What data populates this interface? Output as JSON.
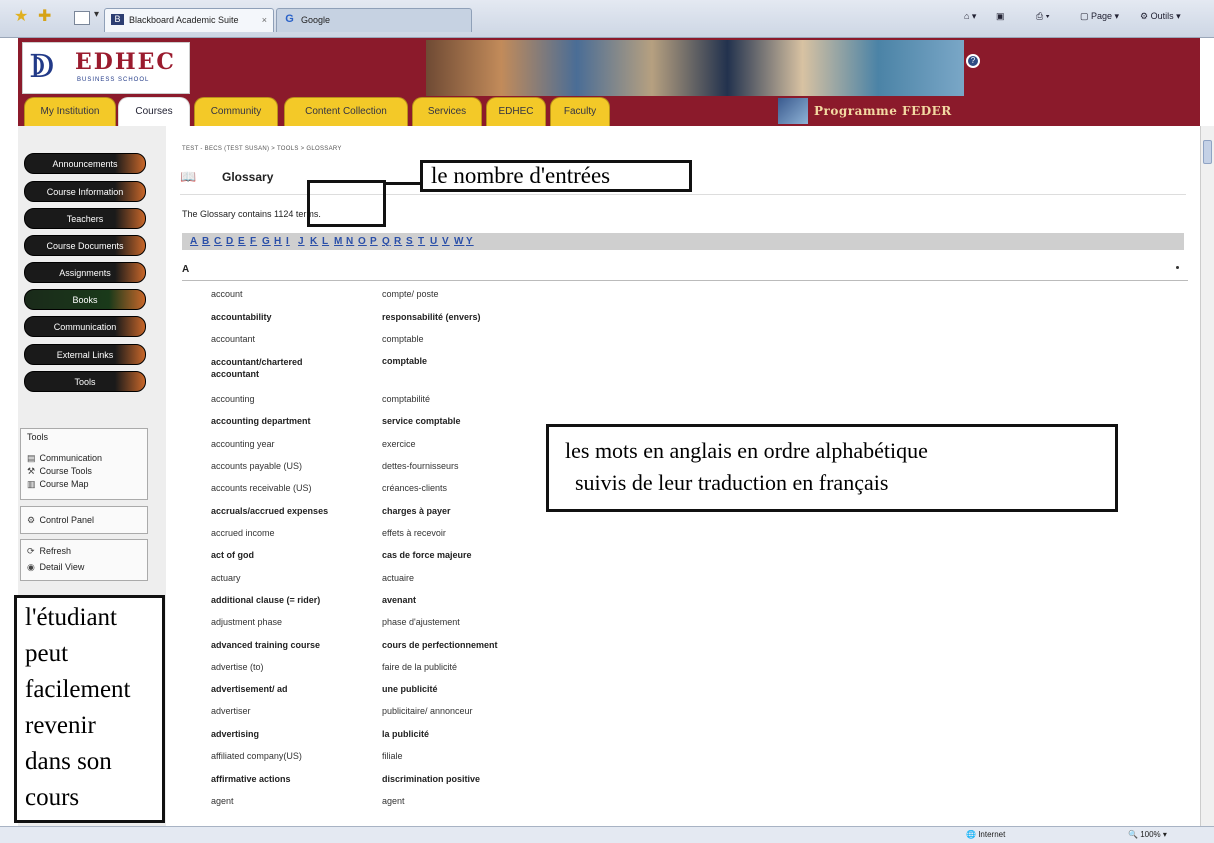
{
  "browser": {
    "tab_active": "Blackboard Academic Suite",
    "tab_other": "Google",
    "cmd_page": "Page",
    "cmd_tools": "Outils"
  },
  "header": {
    "logo_text": "EDHEC",
    "logo_sub": "BUSINESS SCHOOL",
    "program_label": "Programme FEDER",
    "nav_tabs": [
      "My Institution",
      "Courses",
      "Community",
      "Content Collection",
      "Services",
      "EDHEC",
      "Faculty"
    ]
  },
  "course_menu": [
    "Announcements",
    "Course Information",
    "Teachers",
    "Course Documents",
    "Assignments",
    "Books",
    "Communication",
    "External Links",
    "Tools"
  ],
  "tools_panel": {
    "title": "Tools",
    "items": [
      "Communication",
      "Course Tools",
      "Course Map"
    ],
    "control_panel": "Control Panel",
    "refresh": "Refresh",
    "detail_view": "Detail View"
  },
  "main": {
    "breadcrumb": "TEST - BECS (TEST SUSAN) > TOOLS > GLOSSARY",
    "title": "Glossary",
    "summary": "The Glossary contains 1124 terms.",
    "alphabet": "ABCDEFGHIJKLMNOPQRSTUVWY",
    "section_letter": "A"
  },
  "glossary": [
    {
      "en": "account",
      "fr": "compte/ poste"
    },
    {
      "en": "accountability",
      "fr": "responsabilité (envers)"
    },
    {
      "en": "accountant",
      "fr": "comptable"
    },
    {
      "en": "accountant/chartered accountant",
      "fr": "comptable"
    },
    {
      "en": "accounting",
      "fr": "comptabilité"
    },
    {
      "en": "accounting department",
      "fr": "service comptable"
    },
    {
      "en": "accounting year",
      "fr": "exercice"
    },
    {
      "en": "accounts payable (US)",
      "fr": "dettes-fournisseurs"
    },
    {
      "en": "accounts receivable (US)",
      "fr": "créances-clients"
    },
    {
      "en": "accruals/accrued expenses",
      "fr": "charges à payer"
    },
    {
      "en": "accrued income",
      "fr": "effets à recevoir"
    },
    {
      "en": "act of god",
      "fr": "cas de force majeure"
    },
    {
      "en": "actuary",
      "fr": "actuaire"
    },
    {
      "en": "additional clause (= rider)",
      "fr": "avenant"
    },
    {
      "en": "adjustment phase",
      "fr": "phase d'ajustement"
    },
    {
      "en": "advanced training course",
      "fr": "cours de perfectionnement"
    },
    {
      "en": "advertise (to)",
      "fr": "faire de la publicité"
    },
    {
      "en": "advertisement/ ad",
      "fr": "une publicité"
    },
    {
      "en": "advertiser",
      "fr": "publicitaire/ annonceur"
    },
    {
      "en": "advertising",
      "fr": "la publicité"
    },
    {
      "en": "affiliated company(US)",
      "fr": "filiale"
    },
    {
      "en": "affirmative actions",
      "fr": "discrimination positive"
    },
    {
      "en": "agent",
      "fr": "agent"
    }
  ],
  "annotations": {
    "count": "le nombre d'entrées",
    "words_line1": "les mots en anglais en ordre alphabétique",
    "words_line2": "suivis de leur traduction en français",
    "student": [
      "l'étudiant",
      "peut",
      "facilement",
      "revenir",
      "dans son",
      "cours"
    ]
  },
  "status": {
    "zone": "Internet",
    "zoom": "100%"
  },
  "colors": {
    "header_red": "#8b1a2b",
    "tab_yellow": "#f3c928",
    "menu_dark": "#1a1a1a",
    "menu_orange": "#c8672a",
    "link_blue": "#2a4fa8"
  }
}
